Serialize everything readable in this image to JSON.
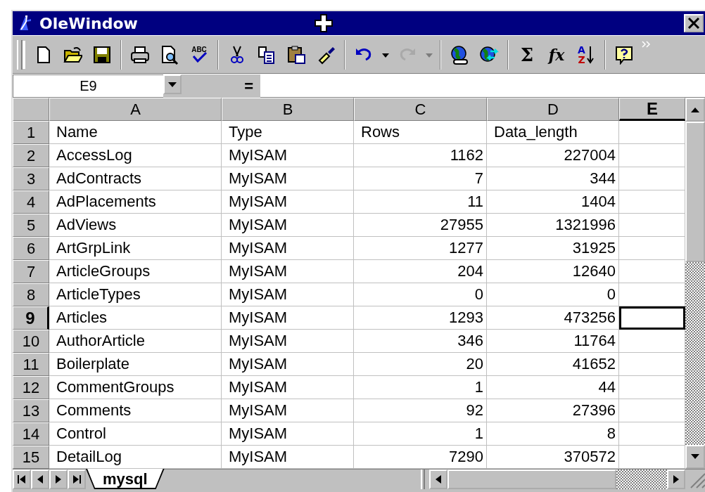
{
  "window": {
    "title": "OleWindow"
  },
  "toolbar": [
    {
      "kind": "grip"
    },
    {
      "kind": "new"
    },
    {
      "kind": "open"
    },
    {
      "kind": "save"
    },
    {
      "kind": "separator"
    },
    {
      "kind": "print"
    },
    {
      "kind": "preview"
    },
    {
      "kind": "spell",
      "letters": [
        "ABC"
      ]
    },
    {
      "kind": "separator"
    },
    {
      "kind": "cut"
    },
    {
      "kind": "copy"
    },
    {
      "kind": "paste"
    },
    {
      "kind": "brush"
    },
    {
      "kind": "separator"
    },
    {
      "kind": "undo",
      "disabled": false
    },
    {
      "kind": "dropdown",
      "disabled": false
    },
    {
      "kind": "redo",
      "disabled": true
    },
    {
      "kind": "dropdown",
      "disabled": true
    },
    {
      "kind": "separator"
    },
    {
      "kind": "globe"
    },
    {
      "kind": "globearrows"
    },
    {
      "kind": "separator"
    },
    {
      "kind": "sum",
      "letters": [
        "Σ"
      ]
    },
    {
      "kind": "function",
      "letters": [
        "fx"
      ]
    },
    {
      "kind": "sort",
      "letters": [
        "A",
        "Z"
      ]
    },
    {
      "kind": "separator"
    },
    {
      "kind": "help"
    },
    {
      "kind": "more"
    }
  ],
  "name_box": {
    "value": "E9"
  },
  "formula_bar": {
    "label": "="
  },
  "columns": [
    {
      "label": "A",
      "selected": false,
      "numeric": false
    },
    {
      "label": "B",
      "selected": false,
      "numeric": false
    },
    {
      "label": "C",
      "selected": false,
      "numeric": true
    },
    {
      "label": "D",
      "selected": false,
      "numeric": true
    },
    {
      "label": "E",
      "selected": true,
      "numeric": false
    }
  ],
  "rows": [
    {
      "header": "1",
      "selected": false,
      "kind": "labels",
      "cells": [
        "Name",
        "Type",
        "Rows",
        "Data_length"
      ]
    },
    {
      "header": "2",
      "selected": false,
      "cells": [
        "AccessLog",
        "MyISAM",
        "1162",
        "227004"
      ]
    },
    {
      "header": "3",
      "selected": false,
      "cells": [
        "AdContracts",
        "MyISAM",
        "7",
        "344"
      ]
    },
    {
      "header": "4",
      "selected": false,
      "cells": [
        "AdPlacements",
        "MyISAM",
        "11",
        "1404"
      ]
    },
    {
      "header": "5",
      "selected": false,
      "cells": [
        "AdViews",
        "MyISAM",
        "27955",
        "1321996"
      ]
    },
    {
      "header": "6",
      "selected": false,
      "cells": [
        "ArtGrpLink",
        "MyISAM",
        "1277",
        "31925"
      ]
    },
    {
      "header": "7",
      "selected": false,
      "cells": [
        "ArticleGroups",
        "MyISAM",
        "204",
        "12640"
      ]
    },
    {
      "header": "8",
      "selected": false,
      "cells": [
        "ArticleTypes",
        "MyISAM",
        "0",
        "0"
      ]
    },
    {
      "header": "9",
      "selected": true,
      "cells": [
        "Articles",
        "MyISAM",
        "1293",
        "473256"
      ]
    },
    {
      "header": "10",
      "selected": false,
      "cells": [
        "AuthorArticle",
        "MyISAM",
        "346",
        "11764"
      ]
    },
    {
      "header": "11",
      "selected": false,
      "cells": [
        "Boilerplate",
        "MyISAM",
        "20",
        "41652"
      ]
    },
    {
      "header": "12",
      "selected": false,
      "cells": [
        "CommentGroups",
        "MyISAM",
        "1",
        "44"
      ]
    },
    {
      "header": "13",
      "selected": false,
      "cells": [
        "Comments",
        "MyISAM",
        "92",
        "27396"
      ]
    },
    {
      "header": "14",
      "selected": false,
      "cells": [
        "Control",
        "MyISAM",
        "1",
        "8"
      ]
    },
    {
      "header": "15",
      "selected": false,
      "cells": [
        "DetailLog",
        "MyISAM",
        "7290",
        "370572"
      ]
    }
  ],
  "sheet_tabs": [
    {
      "label": "mysql",
      "selected": true
    }
  ]
}
